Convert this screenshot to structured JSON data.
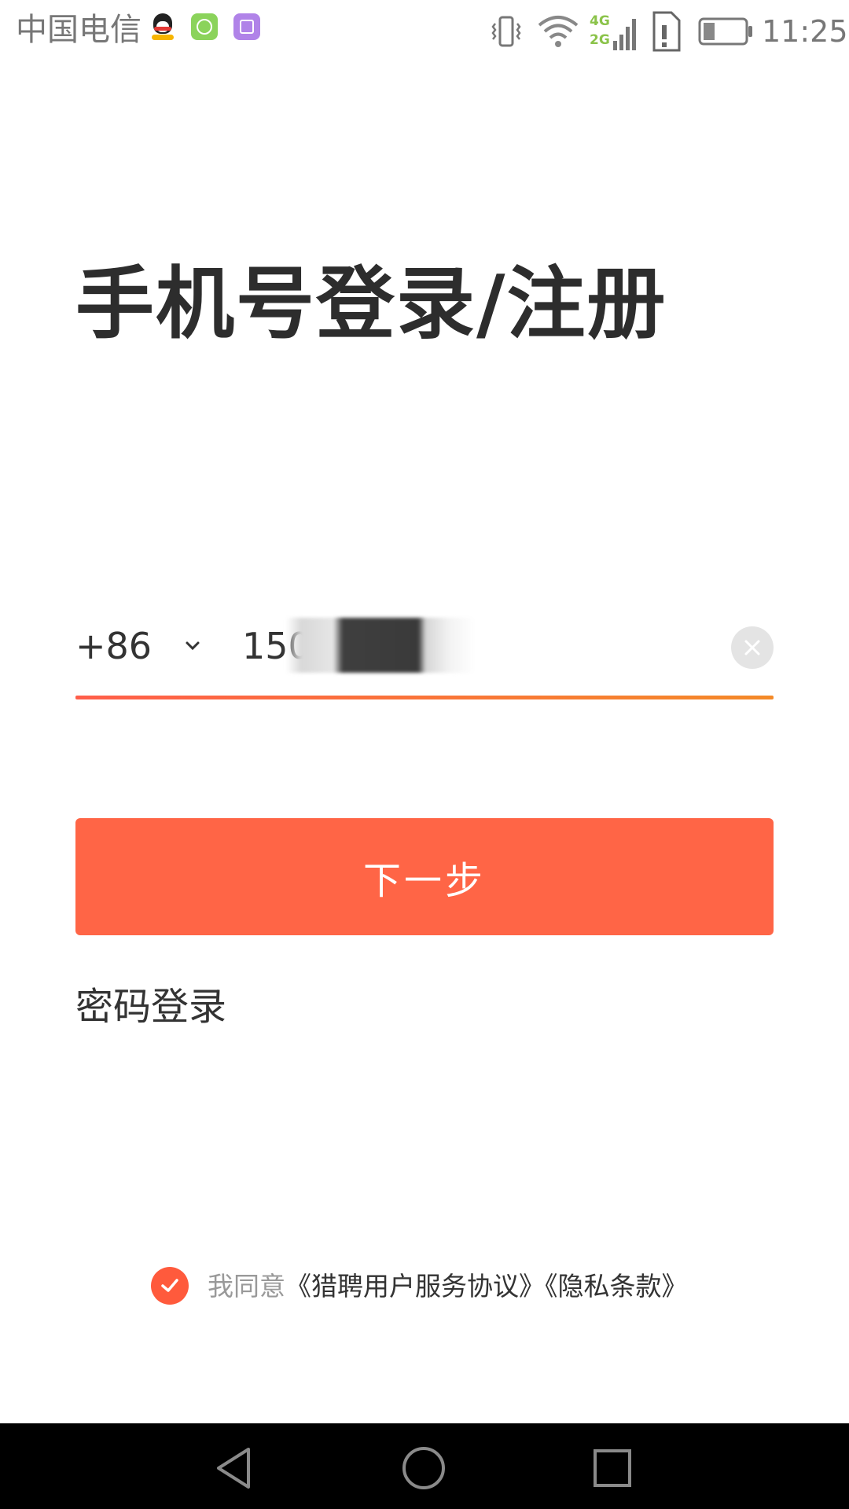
{
  "status_bar": {
    "carrier": "中国电信",
    "time": "11:25",
    "network_labels": {
      "top": "4G",
      "bottom": "2G"
    },
    "icons": [
      "qq-icon",
      "sync-icon",
      "gallery-icon",
      "vibrate-icon",
      "wifi-icon",
      "signal-icon",
      "sim-alert-icon",
      "battery-icon"
    ]
  },
  "title": "手机号登录/注册",
  "phone": {
    "country_code": "+86",
    "value": "150   08"
  },
  "next_button": {
    "label": "下一步"
  },
  "password_login": {
    "label": "密码登录"
  },
  "agreement": {
    "checked": true,
    "prefix": "我同意",
    "service_agreement": "《猎聘用户服务协议》",
    "privacy_policy": "《隐私条款》"
  },
  "colors": {
    "accent": "#ff6546",
    "underline_start": "#ff5e4a",
    "underline_end": "#f48a28",
    "title": "#2d2d2d",
    "muted": "#999999",
    "nav_bar": "#000000"
  }
}
